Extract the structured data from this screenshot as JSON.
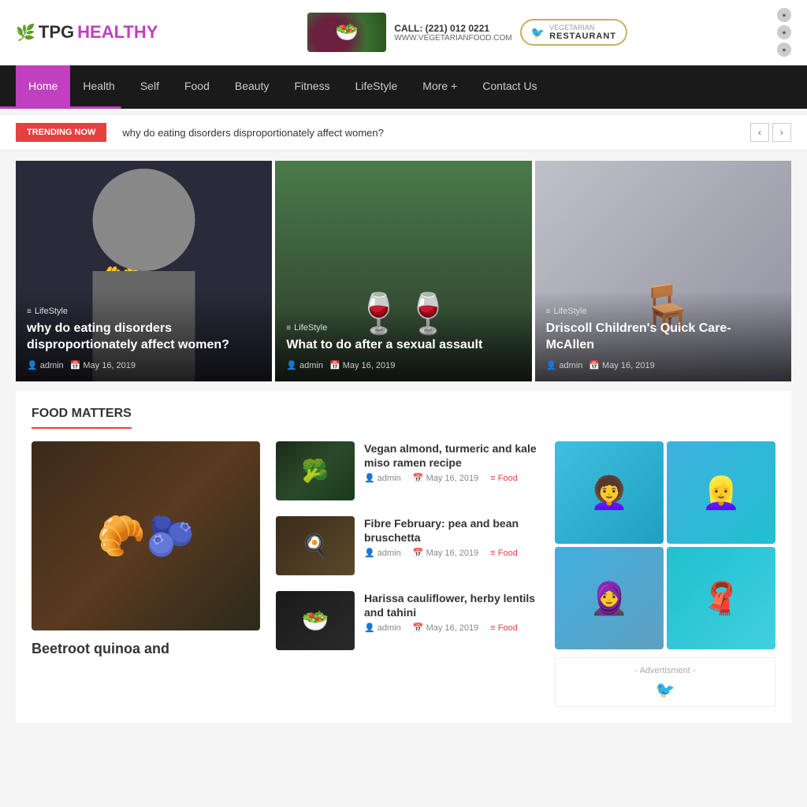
{
  "site": {
    "logo_tpg": "TPG",
    "logo_healthy": "HEALTHY",
    "phone": "CALL: (221) 012 0221",
    "website": "WWW.VEGETARIANFOOD.COM",
    "restaurant_tag": "VEGETARIAN",
    "restaurant_name": "RESTAURANT"
  },
  "nav": {
    "items": [
      {
        "label": "Home",
        "active": true
      },
      {
        "label": "Health",
        "active": false
      },
      {
        "label": "Self",
        "active": false
      },
      {
        "label": "Food",
        "active": false
      },
      {
        "label": "Beauty",
        "active": false
      },
      {
        "label": "Fitness",
        "active": false
      },
      {
        "label": "LifeStyle",
        "active": false
      },
      {
        "label": "More +",
        "active": false
      },
      {
        "label": "Contact Us",
        "active": false
      }
    ]
  },
  "trending": {
    "label": "TRENDING NOW",
    "text": "why do eating disorders disproportionately affect women?"
  },
  "featured": [
    {
      "category": "LifeStyle",
      "title": "why do eating disorders disproportionately affect women?",
      "author": "admin",
      "date": "May 16, 2019",
      "art": "1"
    },
    {
      "category": "LifeStyle",
      "title": "What to do after a sexual assault",
      "author": "admin",
      "date": "May 16, 2019",
      "art": "2"
    },
    {
      "category": "LifeStyle",
      "title": "Driscoll Children's Quick Care- McAllen",
      "author": "admin",
      "date": "May 16, 2019",
      "art": "3"
    }
  ],
  "food_matters": {
    "section_title": "FOOD MATTERS",
    "main_article": {
      "title": "Beetroot quinoa and"
    },
    "articles": [
      {
        "title": "Vegan almond, turmeric and kale miso ramen recipe",
        "author": "admin",
        "date": "May 16, 2019",
        "category": "Food",
        "art": "🥦"
      },
      {
        "title": "Fibre February: pea and bean bruschetta",
        "author": "admin",
        "date": "May 16, 2019",
        "category": "Food",
        "art": "🍳"
      },
      {
        "title": "Harissa cauliflower, herby lentils and tahini",
        "author": "admin",
        "date": "May 16, 2019",
        "category": "Food",
        "art": "🥗"
      }
    ]
  },
  "advertisment": {
    "label": "- Advertisment -"
  }
}
